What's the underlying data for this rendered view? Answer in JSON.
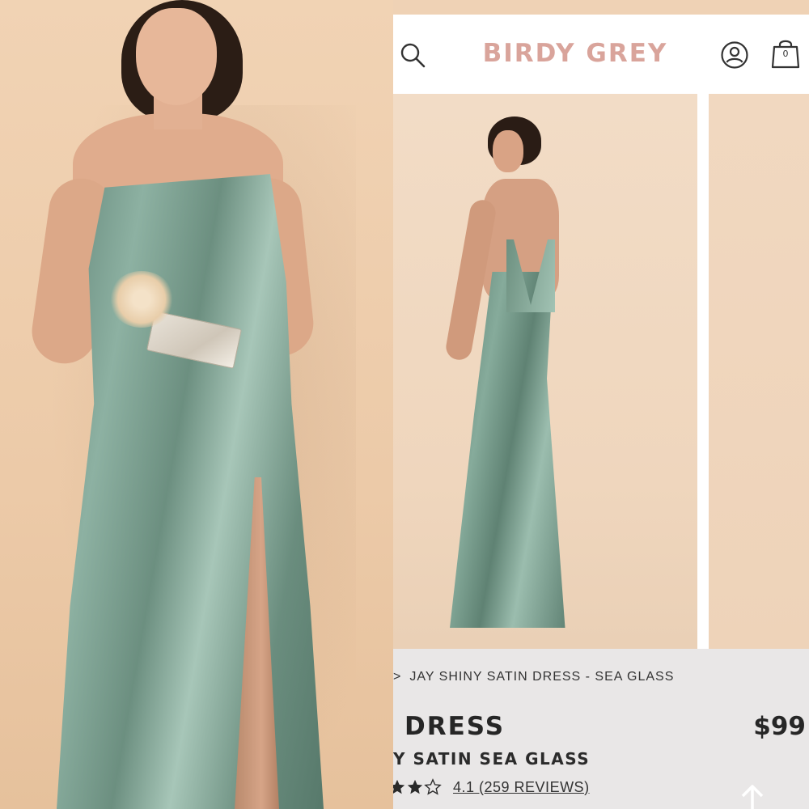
{
  "brand": {
    "name": "BIRDY GREY",
    "color": "#d9a49b"
  },
  "header": {
    "search_icon": "search-icon",
    "account_icon": "account-icon",
    "bag_icon": "shopping-bag-icon",
    "bag_count": "0"
  },
  "photos": {
    "left": "model in sage satin slip dress holding bouquet and clutch",
    "carousel_main": "model back view in sea glass satin dress",
    "carousel_next": "next product photo (partially visible)"
  },
  "product": {
    "breadcrumb_separator": ">",
    "breadcrumb_current": "JAY SHINY SATIN DRESS - SEA GLASS",
    "title_visible": "DRESS",
    "price_visible": "$99",
    "subtitle_visible": "Y SATIN SEA GLASS",
    "rating_value": 4.1,
    "rating_text": "4.1 (259 REVIEWS)",
    "stars_filled_visible": 2,
    "stars_empty_visible": 1
  },
  "colors": {
    "dress": "#7fa393",
    "background": "#efd2b5",
    "info_bg": "#e9e7e7",
    "text": "#262626"
  }
}
